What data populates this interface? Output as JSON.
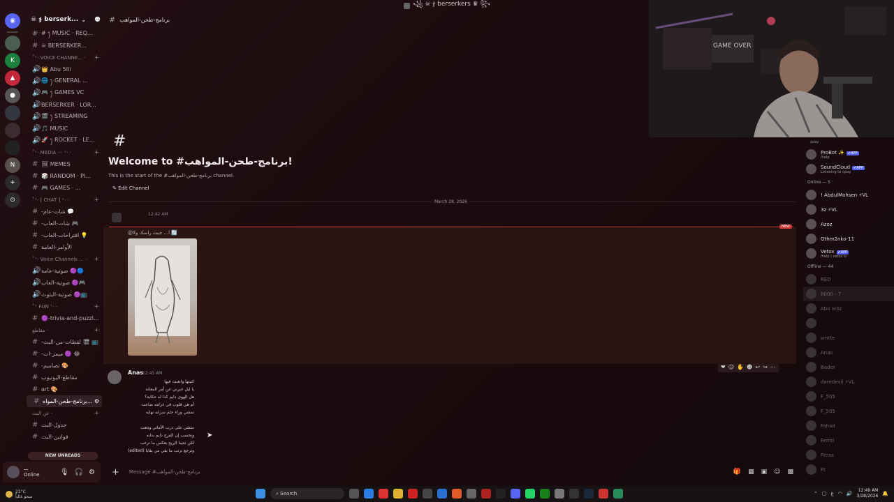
{
  "window": {
    "title": "꧁ ☠ ჯ berserkers ♛ ꧂"
  },
  "server": {
    "name": "☠ ჯ berserk..."
  },
  "channels": [
    {
      "type": "ch",
      "label": "# ꫂ MUSIC · REQ..."
    },
    {
      "type": "ch",
      "label": "☠ BERSERKER..."
    },
    {
      "type": "cat",
      "label": "˚⁺‧ VOICE CHANNE... ·"
    },
    {
      "type": "voice",
      "label": "👑 Abu 5lli"
    },
    {
      "type": "voice",
      "label": "🌐 ꫂ GENERAL ..."
    },
    {
      "type": "voice",
      "label": "🎮 ꫂ GAMES VC"
    },
    {
      "type": "voice",
      "label": "BERSERKER · LOR..."
    },
    {
      "type": "voice",
      "label": "🎬 ꫂ STREAMING"
    },
    {
      "type": "voice",
      "label": "🎵 MUSIC"
    },
    {
      "type": "voice",
      "label": "🚀 ꫂ ROCKET · LE..."
    },
    {
      "type": "cat",
      "label": "˚⁺‧ MEDIA ··· ⁺‧ ·"
    },
    {
      "type": "ch",
      "label": "🖼 MEMES"
    },
    {
      "type": "ch",
      "label": "🎲 RANDOM · PI..."
    },
    {
      "type": "ch",
      "label": "🎮 GAMES · ..."
    },
    {
      "type": "cat",
      "label": "˚⁺‧ [ CHAT ] ⁺‧ ·"
    },
    {
      "type": "ch",
      "label": "-شات-عام 💬"
    },
    {
      "type": "ch",
      "label": "-شات-العاب 🎮"
    },
    {
      "type": "ch",
      "label": "-اقتراحات-العاب 💡"
    },
    {
      "type": "ch",
      "label": "الأوامر-العامة"
    },
    {
      "type": "cat",
      "label": "˚⁺‧ Voice Channels ... ·"
    },
    {
      "type": "voice",
      "label": "صوتية-عامة 🟣🔵"
    },
    {
      "type": "voice",
      "label": "صوتية-العاب 🟣🎮"
    },
    {
      "type": "voice",
      "label": "صوتية-البثوث 🟣📺"
    },
    {
      "type": "cat",
      "label": "˚⁺ FUN ⁺‧ ·"
    },
    {
      "type": "ch",
      "label": "🟣-trivia-and-puzzl..."
    },
    {
      "type": "cat",
      "label": "مقاطع ·"
    },
    {
      "type": "ch",
      "label": "-لقطات-من-البث 🎬 📺"
    },
    {
      "type": "ch",
      "label": "-ميمز-ات 🟣 😂"
    },
    {
      "type": "ch",
      "label": "-تصاميم 🎨"
    },
    {
      "type": "ch",
      "label": "مقاطع-اليوتيوب"
    },
    {
      "type": "ch",
      "label": "art 🎨"
    },
    {
      "type": "active",
      "label": "برنامج-طحن-المواه..."
    },
    {
      "type": "cat",
      "label": "عن البث ·"
    },
    {
      "type": "ch",
      "label": "جدول-البث"
    },
    {
      "type": "ch",
      "label": "قوانين-البث"
    }
  ],
  "sidebar": {
    "new_unreads": "NEW UNREADS"
  },
  "user_panel": {
    "name": "ـــ",
    "status": "Online"
  },
  "header": {
    "channel": "برنامج-طحن-المواهب"
  },
  "welcome": {
    "hash": "#",
    "title": "Welcome to #برنامج-طحن-المواهب!",
    "subtitle": "This is the start of the #برنامج-طحن-المواهب channel.",
    "edit": "Edit Channel"
  },
  "divider": {
    "date": "March 28, 2026",
    "new": "NEW"
  },
  "message1": {
    "time": "12:42 AM",
    "reply": "@ا... جبت راسك ولا 🔄"
  },
  "message2": {
    "author": "Anas",
    "time": "12:45 AM",
    "body": "كتبتها وانعبت فيها\nيا ليل خبرني عن أمر المعانة\nهل الهوى دايم كذا له حكاية؟\nأم هي قلوب في غرامه ضاعت\nتمشي وراء حلم سرابه نهايه\n\nنمشي على درب الأماني ونتعب\nونحسب إن الفرح دايم بدايه\nلكن تجينا الريح بعكس ما نرغب\nونرجع نرتب ما بقي من بقايا (edited)"
  },
  "composer": {
    "placeholder": "Message #برنامج-طحن-المواهب"
  },
  "members": {
    "bots": [
      {
        "name": "ProBot ✨",
        "badge": "✔APP",
        "status": "/help"
      },
      {
        "name": "SoundCloud",
        "badge": "✔APP",
        "status": "Listening to /play"
      }
    ],
    "online_label": "Online — 5",
    "online": [
      {
        "name": "! AbdulMohsen ⚡VL"
      },
      {
        "name": "3z ⚡VL"
      },
      {
        "name": "Azoz"
      },
      {
        "name": "Othm2nko-11"
      },
      {
        "name": "Vetox",
        "badge": "✔APP",
        "status": "/help | vetox.io"
      }
    ],
    "offline_label": "Offline — 44",
    "offline": [
      "RED",
      "8000 - 7",
      "Abo al3z",
      "",
      "smrte",
      "Anas",
      "Bader",
      "daredevil ⚡VL",
      "F_505",
      "F_505",
      "Fahad",
      "Femti",
      "Feras",
      "Ft"
    ]
  },
  "webcam": {
    "sign": "GAME OVER"
  },
  "taskbar": {
    "temp": "21°C",
    "weather": "صحو غالباً",
    "search": "Search",
    "lang": "ع",
    "time": "12:49 AM",
    "date": "3/28/2026"
  },
  "colors": {
    "accent": "#5865f2",
    "new_red": "#d43b3b"
  }
}
